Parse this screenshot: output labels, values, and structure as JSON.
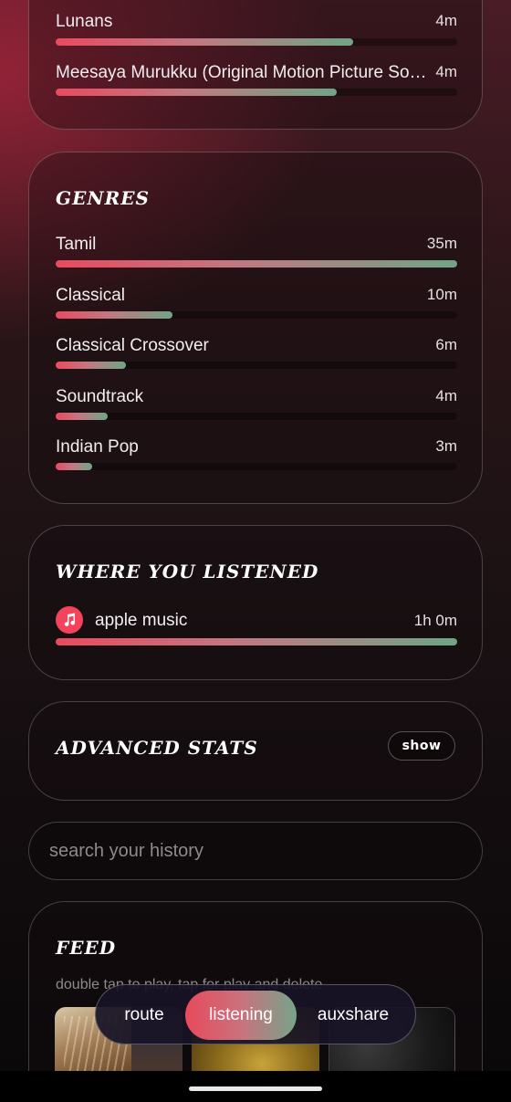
{
  "top_card": {
    "tracks": [
      {
        "label": "Lunans",
        "time": "4m",
        "fill": 0.74
      },
      {
        "label": "Meesaya Murukku (Original Motion Picture So…",
        "time": "4m",
        "fill": 0.7
      }
    ]
  },
  "genres": {
    "title": "GENRES",
    "items": [
      {
        "label": "Tamil",
        "time": "35m",
        "fill": 1.0
      },
      {
        "label": "Classical",
        "time": "10m",
        "fill": 0.29
      },
      {
        "label": "Classical Crossover",
        "time": "6m",
        "fill": 0.175
      },
      {
        "label": "Soundtrack",
        "time": "4m",
        "fill": 0.13
      },
      {
        "label": "Indian Pop",
        "time": "3m",
        "fill": 0.09
      }
    ]
  },
  "where": {
    "title": "WHERE YOU LISTENED",
    "source_label": "apple music",
    "source_time": "1h 0m",
    "source_icon": "apple-music-icon",
    "fill": 1.0
  },
  "advanced": {
    "title": "ADVANCED STATS",
    "show_label": "show"
  },
  "search": {
    "placeholder": "search your history"
  },
  "feed": {
    "title": "FEED",
    "hint": "double tap to play, tap for play and delete"
  },
  "nav": {
    "items": [
      {
        "label": "route",
        "active": false
      },
      {
        "label": "listening",
        "active": true
      },
      {
        "label": "auxshare",
        "active": false
      }
    ]
  },
  "colors": {
    "accent_start": "#ea4a60",
    "accent_end": "#6fa585",
    "apple_music": "#f5435b"
  }
}
